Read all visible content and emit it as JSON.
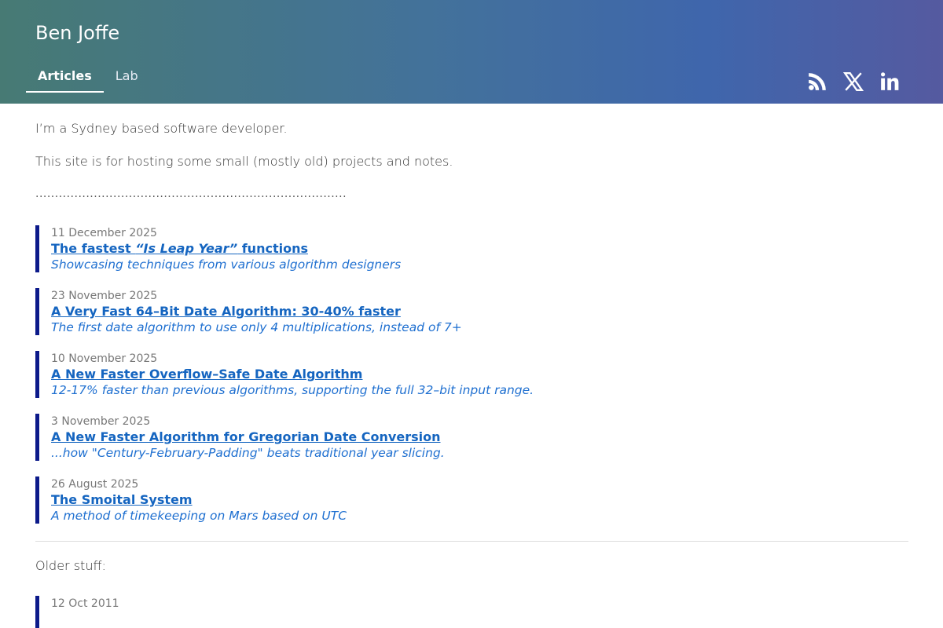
{
  "site": {
    "title": "Ben Joffe"
  },
  "nav": {
    "tabs": [
      {
        "label": "Articles"
      },
      {
        "label": "Lab"
      }
    ]
  },
  "social": {
    "icons": [
      "rss-icon",
      "x-icon",
      "linkedin-icon"
    ]
  },
  "intro": {
    "line1": "I’m a Sydney based software developer.",
    "line2": "This site is for hosting some small (mostly old) projects and notes.",
    "dots": "................................................................................"
  },
  "articles": [
    {
      "date": "11 December 2025",
      "title_prefix": "The fastest ",
      "title_em": "“Is Leap Year”",
      "title_suffix": " functions",
      "subtitle": "Showcasing techniques from various algorithm designers"
    },
    {
      "date": "23 November 2025",
      "title": "A Very Fast 64–Bit Date Algorithm: 30-40% faster",
      "subtitle": "The first date algorithm to use only 4 multiplications, instead of 7+"
    },
    {
      "date": "10 November 2025",
      "title": "A New Faster Overflow–Safe Date Algorithm",
      "subtitle": "12-17% faster than previous algorithms, supporting the full 32–bit input range."
    },
    {
      "date": "3 November 2025",
      "title": "A New Faster Algorithm for Gregorian Date Conversion",
      "subtitle": "...how \"Century-February-Padding\" beats traditional year slicing."
    },
    {
      "date": "26 August 2025",
      "title": "The Smoital System",
      "subtitle": "A method of timekeeping on Mars based on UTC"
    }
  ],
  "older": {
    "label": "Older stuff:",
    "articles": [
      {
        "date": "12 Oct 2011"
      }
    ]
  },
  "colors": {
    "accent_bar": "#0c1a8a",
    "link": "#1565c0",
    "header_start": "#477a74",
    "header_end": "#555aa0"
  }
}
